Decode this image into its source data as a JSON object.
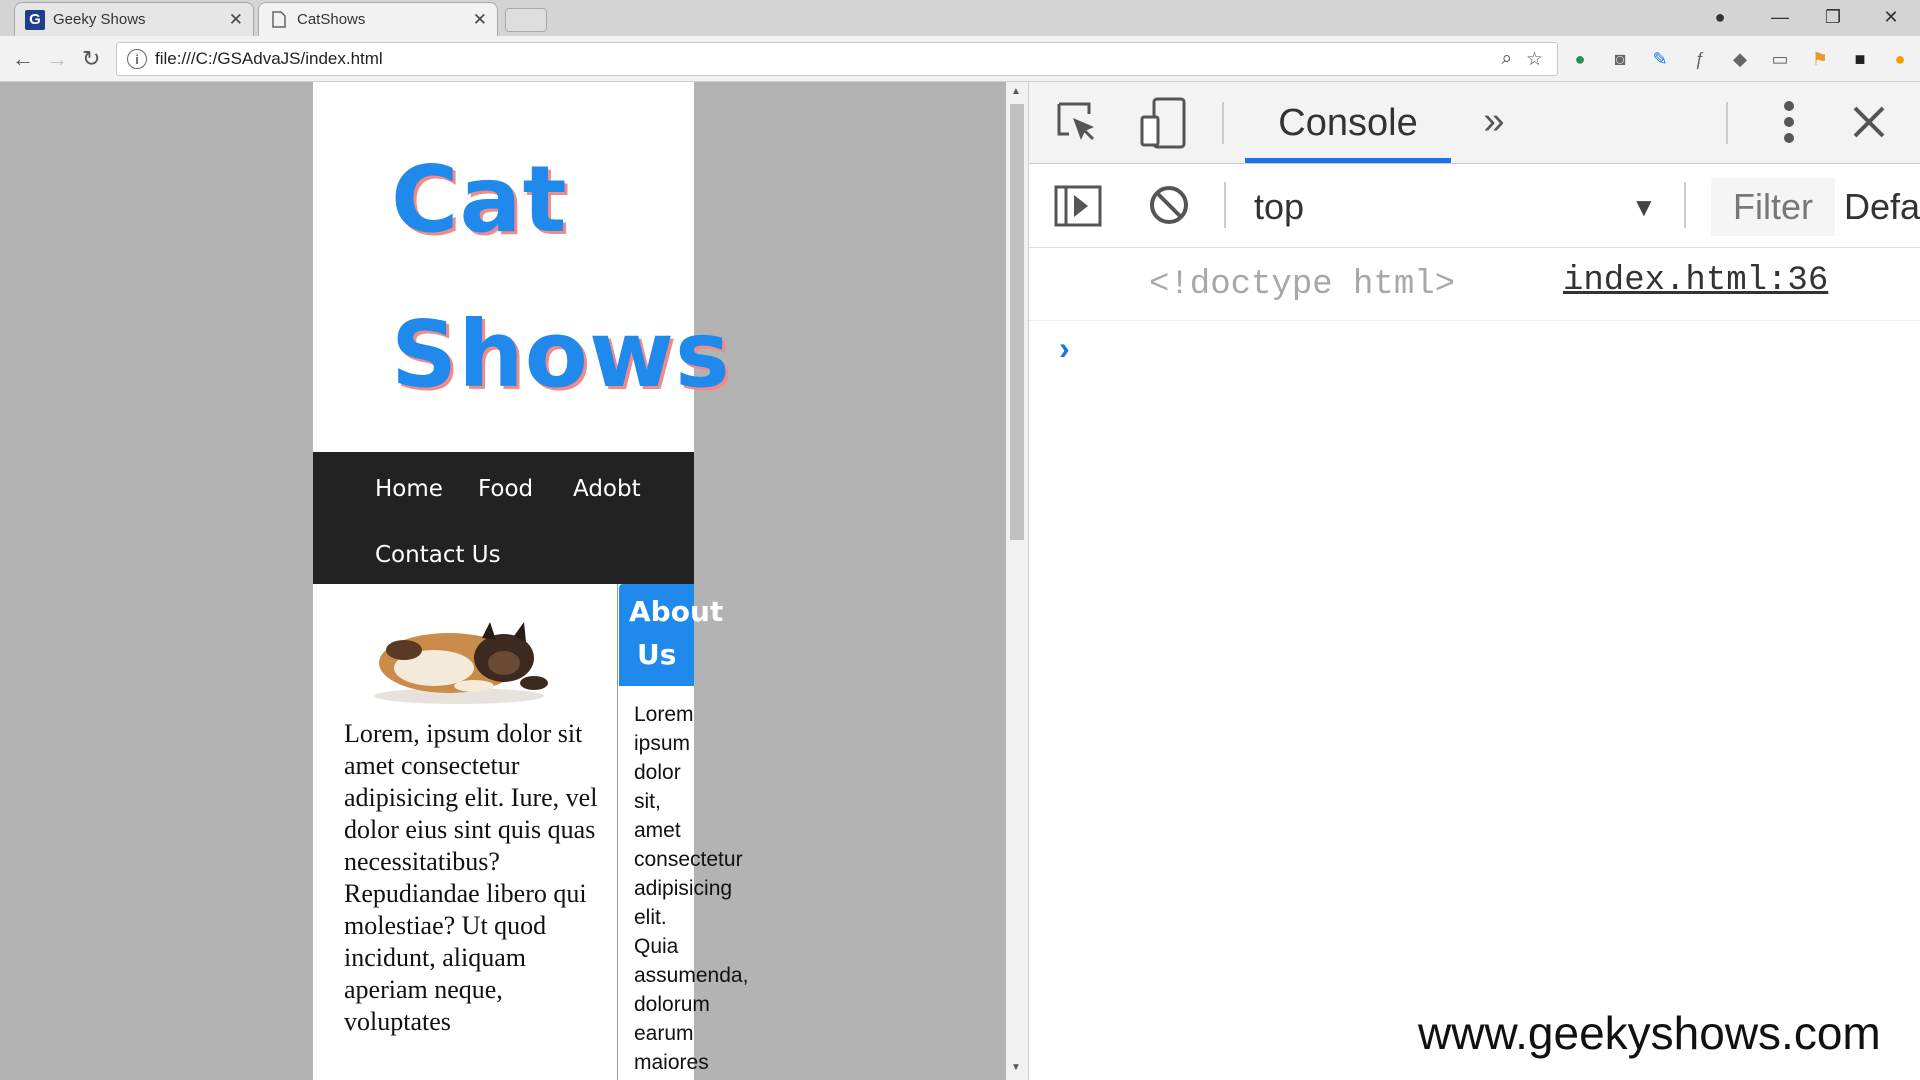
{
  "tabs": [
    {
      "title": "Geeky Shows",
      "icon": "geekyshows-favicon"
    },
    {
      "title": "CatShows",
      "icon": "page-icon"
    }
  ],
  "toolbar": {
    "url": "file:///C:/GSAdvaJS/index.html"
  },
  "site": {
    "title_line1": "Cat",
    "title_line2": "Shows",
    "nav": [
      "Home",
      "Food",
      "Adobt",
      "Contact Us"
    ],
    "lorem_left": "Lorem, ipsum dolor sit amet consectetur adipisicing elit. Iure, vel dolor eius sint quis quas necessitatibus? Repudiandae libero qui molestiae? Ut quod incidunt, aliquam aperiam neque, voluptates",
    "about_line1": "About",
    "about_line2": "Us",
    "lorem_right": [
      "Lorem",
      "ipsum",
      "dolor",
      "sit,",
      "amet",
      "consectetur",
      "adipisicing",
      "elit.",
      "Quia",
      "assumenda,",
      "dolorum",
      "earum",
      "maiores"
    ],
    "accent_color": "#1f8aec",
    "title_shadow_color": "#f28a8a",
    "nav_background": "#222222"
  },
  "devtools": {
    "active_tab": "Console",
    "more_tabs_glyph": "»",
    "context": "top",
    "filter_placeholder": "Filter",
    "levels_label": "Defa",
    "message": "<!doctype html>",
    "message_source": "index.html:36",
    "prompt_glyph": "›"
  },
  "watermark": "www.geekyshows.com"
}
